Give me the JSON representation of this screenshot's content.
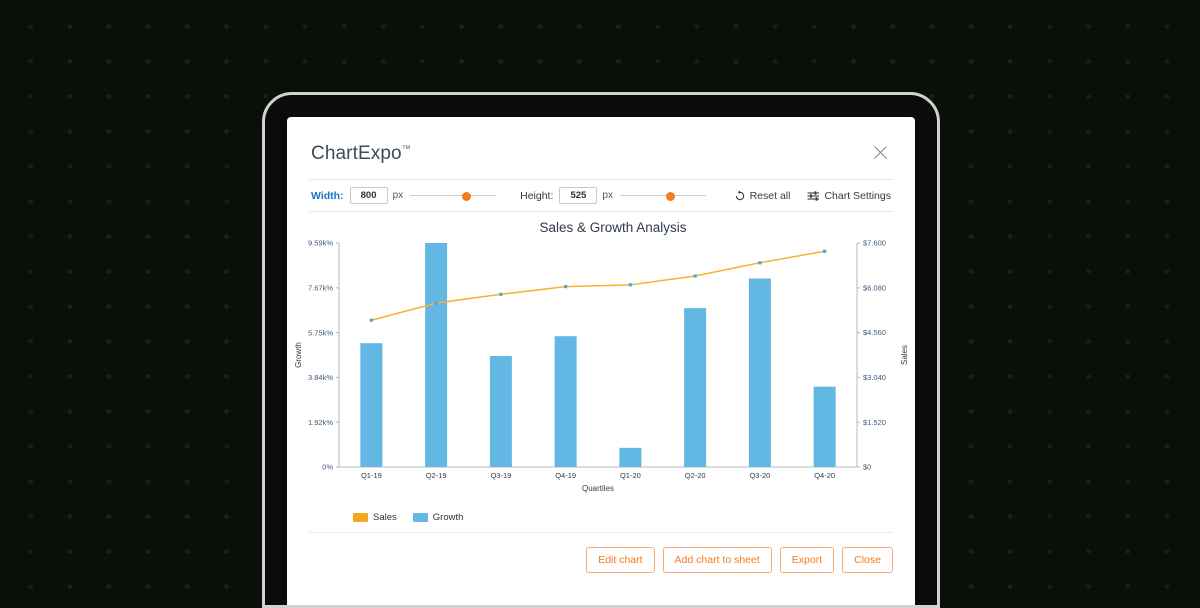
{
  "background": {
    "glow_color": "#1f9e45",
    "base_color": "#050b06"
  },
  "modal": {
    "brand": "ChartExpo",
    "brand_tm": "™",
    "close_icon": "close-icon"
  },
  "toolbar": {
    "width_label": "Width:",
    "width_value": "800",
    "width_unit": "px",
    "height_label": "Height:",
    "height_value": "525",
    "height_unit": "px",
    "reset_label": "Reset all",
    "reset_icon": "undo-icon",
    "settings_label": "Chart Settings",
    "settings_icon": "sliders-icon",
    "slider_thumb_color": "#f47b20"
  },
  "footer": {
    "edit_chart": "Edit chart",
    "add_chart_to_sheet": "Add chart to sheet",
    "export": "Export",
    "close": "Close",
    "accent_color": "#f47b20"
  },
  "chart_data": {
    "type": "bar",
    "title": "Sales & Growth Analysis",
    "xlabel": "Quartiles",
    "ylabel": "Growth",
    "y2label": "Sales",
    "categories": [
      "Q1-19",
      "Q2-19",
      "Q3-19",
      "Q4-19",
      "Q1-20",
      "Q2-20",
      "Q3-20",
      "Q4-20"
    ],
    "ytick_labels": [
      "0%",
      "1.92k%",
      "3.84k%",
      "5.75k%",
      "7.67k%",
      "9.59k%"
    ],
    "ytick_values": [
      0,
      1920,
      3840,
      5750,
      7670,
      9590
    ],
    "y2tick_labels": [
      "$0",
      "$1.520",
      "$3.040",
      "$4.560",
      "$6.080",
      "$7.600"
    ],
    "y2tick_values": [
      0,
      1520,
      3040,
      4560,
      6080,
      7600
    ],
    "ylim": [
      0,
      9590
    ],
    "y2lim": [
      0,
      7600
    ],
    "grid": false,
    "legend_position": "bottom-left",
    "series": [
      {
        "name": "Sales",
        "chart_type": "line",
        "color": "#f5b335",
        "axis": "right",
        "values": [
          4980,
          5560,
          5860,
          6120,
          6180,
          6480,
          6930,
          7320
        ]
      },
      {
        "name": "Growth",
        "chart_type": "bar",
        "color": "#62b7e3",
        "axis": "left",
        "values": [
          5300,
          9590,
          4750,
          5600,
          820,
          6800,
          8070,
          3440
        ]
      }
    ]
  }
}
